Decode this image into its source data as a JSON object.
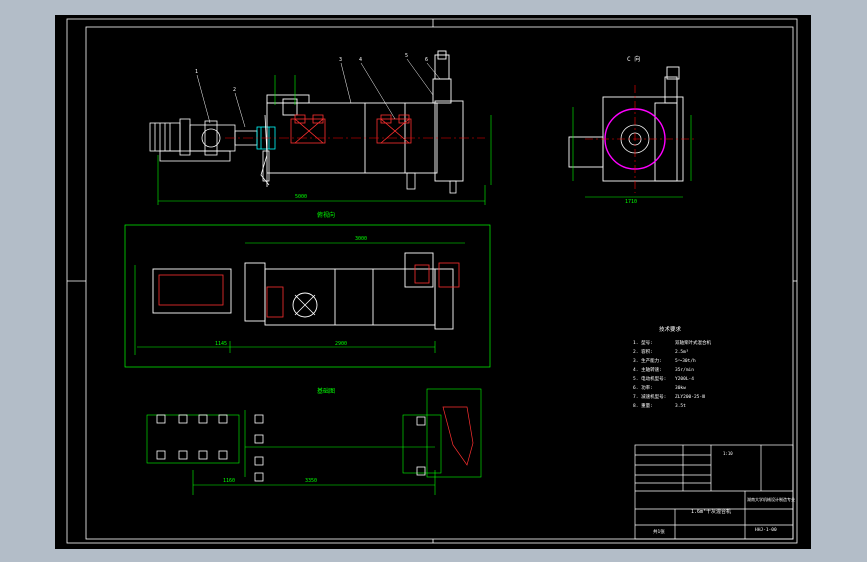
{
  "sheet": {
    "background_color": "#000000",
    "viewport_color": "#b3bdc8",
    "line_colors": {
      "frame": "#ffffff",
      "outline": "#ffffff",
      "dimension": "#00ff00",
      "detail": "#ff3030",
      "hidden": "#ff00ff",
      "center": "#ff0000"
    }
  },
  "labels": {
    "side_view_title": "C 向",
    "top_view_title": "俯视向",
    "foundation_title": "基础图",
    "tech_spec_title": "技术要求",
    "tech_spec_items": [
      "1. 型号:",
      "2. 容积:",
      "3. 生产能力:",
      "4. 主轴转速:",
      "5. 电动机型号:",
      "6. 功率:",
      "7. 减速机型号:",
      "8. 重量:"
    ],
    "tech_spec_values": [
      "双轴桨叶式混合机",
      "2.5m³",
      "5～30t/h",
      "35r/min",
      "Y200L-4",
      "30kw",
      "ZLY200-25-Ⅲ",
      "3.5t"
    ],
    "overall_length_dim": "5000",
    "top_length_dim": "3000",
    "top_total_dim": "2900",
    "foundation_length_dim": "3350",
    "foundation_left_dim": "1160",
    "side_width_dim": "1710",
    "top_left_dim": "1145",
    "title_block_drawing_name": "1.6m³干灰混合机",
    "title_block_scale": "1:10",
    "title_block_company": "湖南大学机械设计制造专业",
    "title_block_number": "HHJ-1-00",
    "title_block_sheet": "共1张",
    "part_numbers": [
      "1",
      "2",
      "3",
      "4",
      "5",
      "6",
      "7",
      "8",
      "9"
    ]
  }
}
